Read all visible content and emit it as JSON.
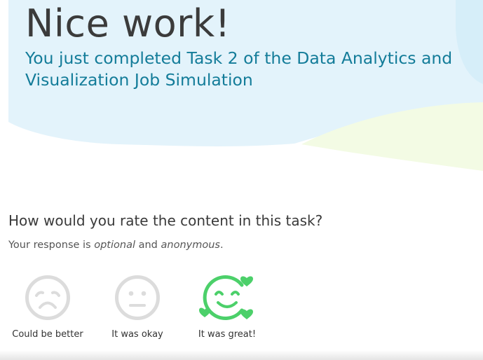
{
  "hero": {
    "title": "Nice work!",
    "subtitle": "You just completed Task 2 of the Data Analytics and Visualization Job Simulation"
  },
  "rating": {
    "question": "How would you rate the content in this task?",
    "note_prefix": "Your response is ",
    "note_optional": "optional",
    "note_and": " and ",
    "note_anonymous": "anonymous",
    "note_suffix": ".",
    "options": [
      {
        "label": "Could be better",
        "icon": "sad-face-icon",
        "selected": false
      },
      {
        "label": "It was okay",
        "icon": "neutral-face-icon",
        "selected": false
      },
      {
        "label": "It was great!",
        "icon": "happy-face-icon",
        "selected": true
      }
    ]
  },
  "colors": {
    "title": "#3b3b3b",
    "subtitle": "#137c99",
    "hero_blue": "#e3f3fb",
    "hero_green": "#f3fbe4",
    "icon_inactive": "#dcdcdc",
    "icon_selected": "#4cd06a"
  }
}
